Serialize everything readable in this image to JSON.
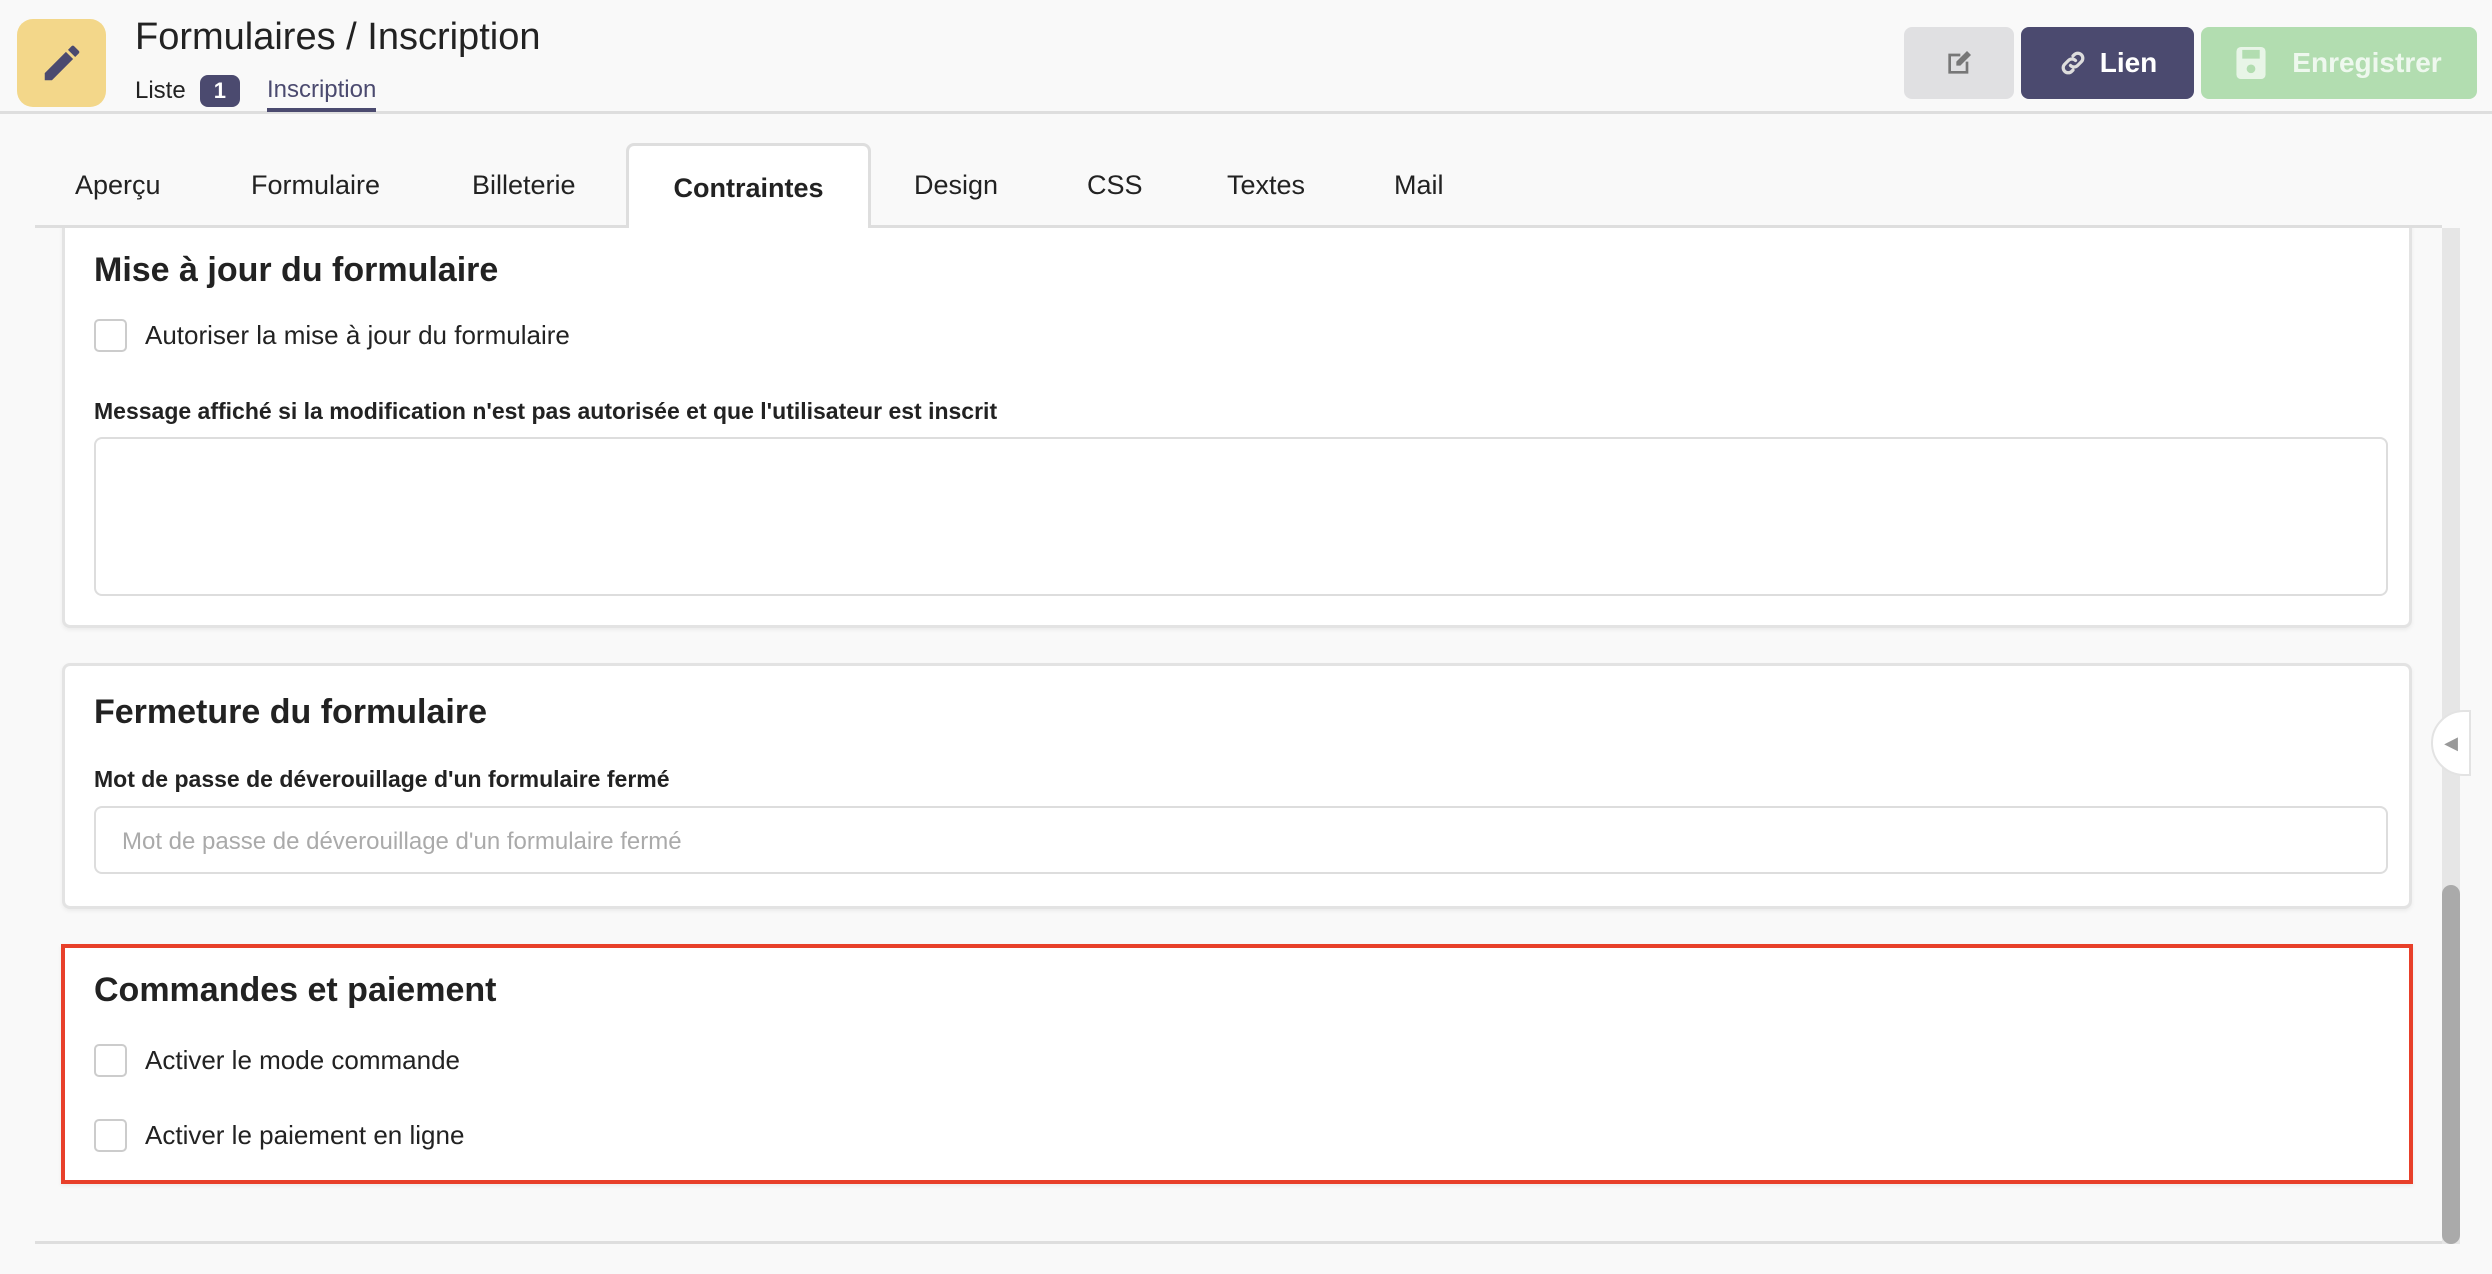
{
  "header": {
    "title": "Formulaires / Inscription",
    "breadcrumb": {
      "list_label": "Liste",
      "count": "1",
      "current": "Inscription"
    },
    "buttons": {
      "edit_icon": "edit-icon",
      "link_label": "Lien",
      "save_label": "Enregistrer"
    }
  },
  "tabs": [
    {
      "label": "Aperçu"
    },
    {
      "label": "Formulaire"
    },
    {
      "label": "Billeterie"
    },
    {
      "label": "Contraintes",
      "active": true
    },
    {
      "label": "Design"
    },
    {
      "label": "CSS"
    },
    {
      "label": "Textes"
    },
    {
      "label": "Mail"
    }
  ],
  "sections": {
    "update": {
      "title": "Mise à jour du formulaire",
      "checkbox": "Autoriser la mise à jour du formulaire",
      "checked": false,
      "message_label": "Message affiché si la modification n'est pas autorisée et que l'utilisateur est inscrit",
      "message_value": ""
    },
    "closing": {
      "title": "Fermeture du formulaire",
      "password_label": "Mot de passe de déverouillage d'un formulaire fermé",
      "password_placeholder": "Mot de passe de déverouillage d'un formulaire fermé"
    },
    "orders": {
      "title": "Commandes et paiement",
      "order_mode": "Activer le mode commande",
      "online_payment": "Activer le paiement en ligne",
      "order_checked": false,
      "payment_checked": false
    }
  },
  "colors": {
    "primary": "#4b4a6f",
    "save": "#b2ddb0",
    "icon_bg": "#f3d78a",
    "highlight": "#e8402a"
  }
}
